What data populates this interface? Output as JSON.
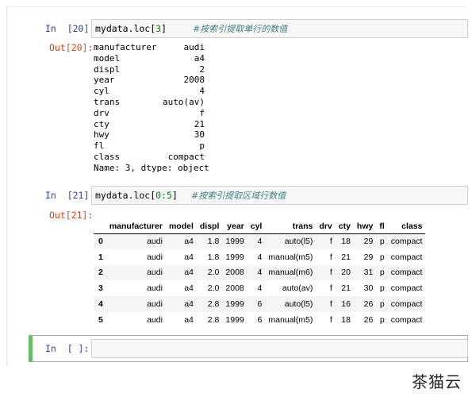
{
  "cells": [
    {
      "in_prompt": "In  [20]:",
      "code_prefix": "mydata.loc[",
      "code_num": "3",
      "code_suffix": "]",
      "comment": "#按索引提取单行的数值",
      "out_prompt": "Out[20]:",
      "series": [
        {
          "key": "manufacturer",
          "value": "audi"
        },
        {
          "key": "model",
          "value": "a4"
        },
        {
          "key": "displ",
          "value": "2"
        },
        {
          "key": "year",
          "value": "2008"
        },
        {
          "key": "cyl",
          "value": "4"
        },
        {
          "key": "trans",
          "value": "auto(av)"
        },
        {
          "key": "drv",
          "value": "f"
        },
        {
          "key": "cty",
          "value": "21"
        },
        {
          "key": "hwy",
          "value": "30"
        },
        {
          "key": "fl",
          "value": "p"
        },
        {
          "key": "class",
          "value": "compact"
        }
      ],
      "series_footer": "Name: 3, dtype: object"
    },
    {
      "in_prompt": "In  [21]:",
      "code_prefix": "mydata.loc[",
      "code_num": "0:5",
      "code_suffix": "]",
      "comment": "#按索引提取区域行数值",
      "out_prompt": "Out[21]:",
      "table": {
        "columns": [
          "",
          "manufacturer",
          "model",
          "displ",
          "year",
          "cyl",
          "trans",
          "drv",
          "cty",
          "hwy",
          "fl",
          "class"
        ],
        "rows": [
          [
            "0",
            "audi",
            "a4",
            "1.8",
            "1999",
            "4",
            "auto(l5)",
            "f",
            "18",
            "29",
            "p",
            "compact"
          ],
          [
            "1",
            "audi",
            "a4",
            "1.8",
            "1999",
            "4",
            "manual(m5)",
            "f",
            "21",
            "29",
            "p",
            "compact"
          ],
          [
            "2",
            "audi",
            "a4",
            "2.0",
            "2008",
            "4",
            "manual(m6)",
            "f",
            "20",
            "31",
            "p",
            "compact"
          ],
          [
            "3",
            "audi",
            "a4",
            "2.0",
            "2008",
            "4",
            "auto(av)",
            "f",
            "21",
            "30",
            "p",
            "compact"
          ],
          [
            "4",
            "audi",
            "a4",
            "2.8",
            "1999",
            "6",
            "auto(l5)",
            "f",
            "16",
            "26",
            "p",
            "compact"
          ],
          [
            "5",
            "audi",
            "a4",
            "2.8",
            "1999",
            "6",
            "manual(m5)",
            "f",
            "18",
            "26",
            "p",
            "compact"
          ]
        ]
      }
    },
    {
      "in_prompt": "In  [ ]:"
    }
  ],
  "watermark": "茶猫云",
  "colors": {
    "in_prompt": "#303f9f",
    "out_prompt": "#d84315",
    "comment": "#408080",
    "number": "#008000",
    "active_cell_border": "#66bb6a"
  }
}
